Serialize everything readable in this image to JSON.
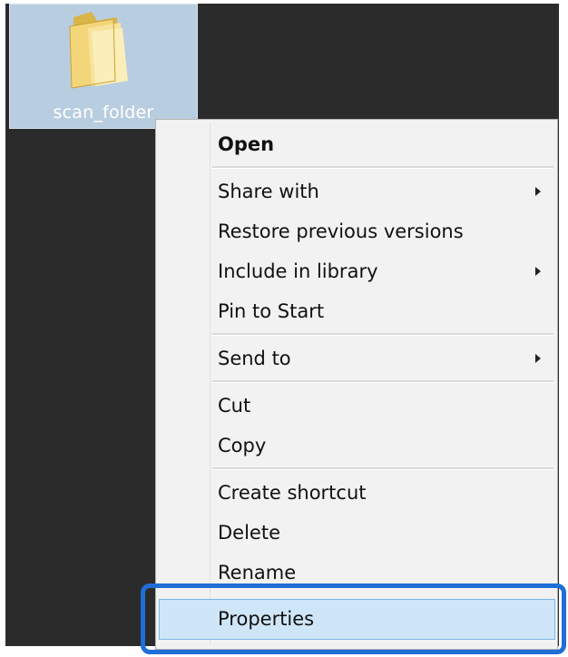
{
  "folder": {
    "name": "scan_folder",
    "icon": "folder-icon"
  },
  "context_menu": {
    "items": [
      {
        "label": "Open",
        "bold": true,
        "submenu": false
      },
      {
        "label": "Share with",
        "bold": false,
        "submenu": true
      },
      {
        "label": "Restore previous versions",
        "bold": false,
        "submenu": false
      },
      {
        "label": "Include in library",
        "bold": false,
        "submenu": true
      },
      {
        "label": "Pin to Start",
        "bold": false,
        "submenu": false
      },
      {
        "label": "Send to",
        "bold": false,
        "submenu": true
      },
      {
        "label": "Cut",
        "bold": false,
        "submenu": false
      },
      {
        "label": "Copy",
        "bold": false,
        "submenu": false
      },
      {
        "label": "Create shortcut",
        "bold": false,
        "submenu": false
      },
      {
        "label": "Delete",
        "bold": false,
        "submenu": false
      },
      {
        "label": "Rename",
        "bold": false,
        "submenu": false
      },
      {
        "label": "Properties",
        "bold": false,
        "submenu": false,
        "highlighted": true
      }
    ]
  },
  "colors": {
    "desktop": "#2b2b2b",
    "selection": "#b9cde0",
    "menu_bg": "#f2f2f2",
    "highlight_ring": "#1f6fd6",
    "hover_bg": "#cfe6f8"
  }
}
